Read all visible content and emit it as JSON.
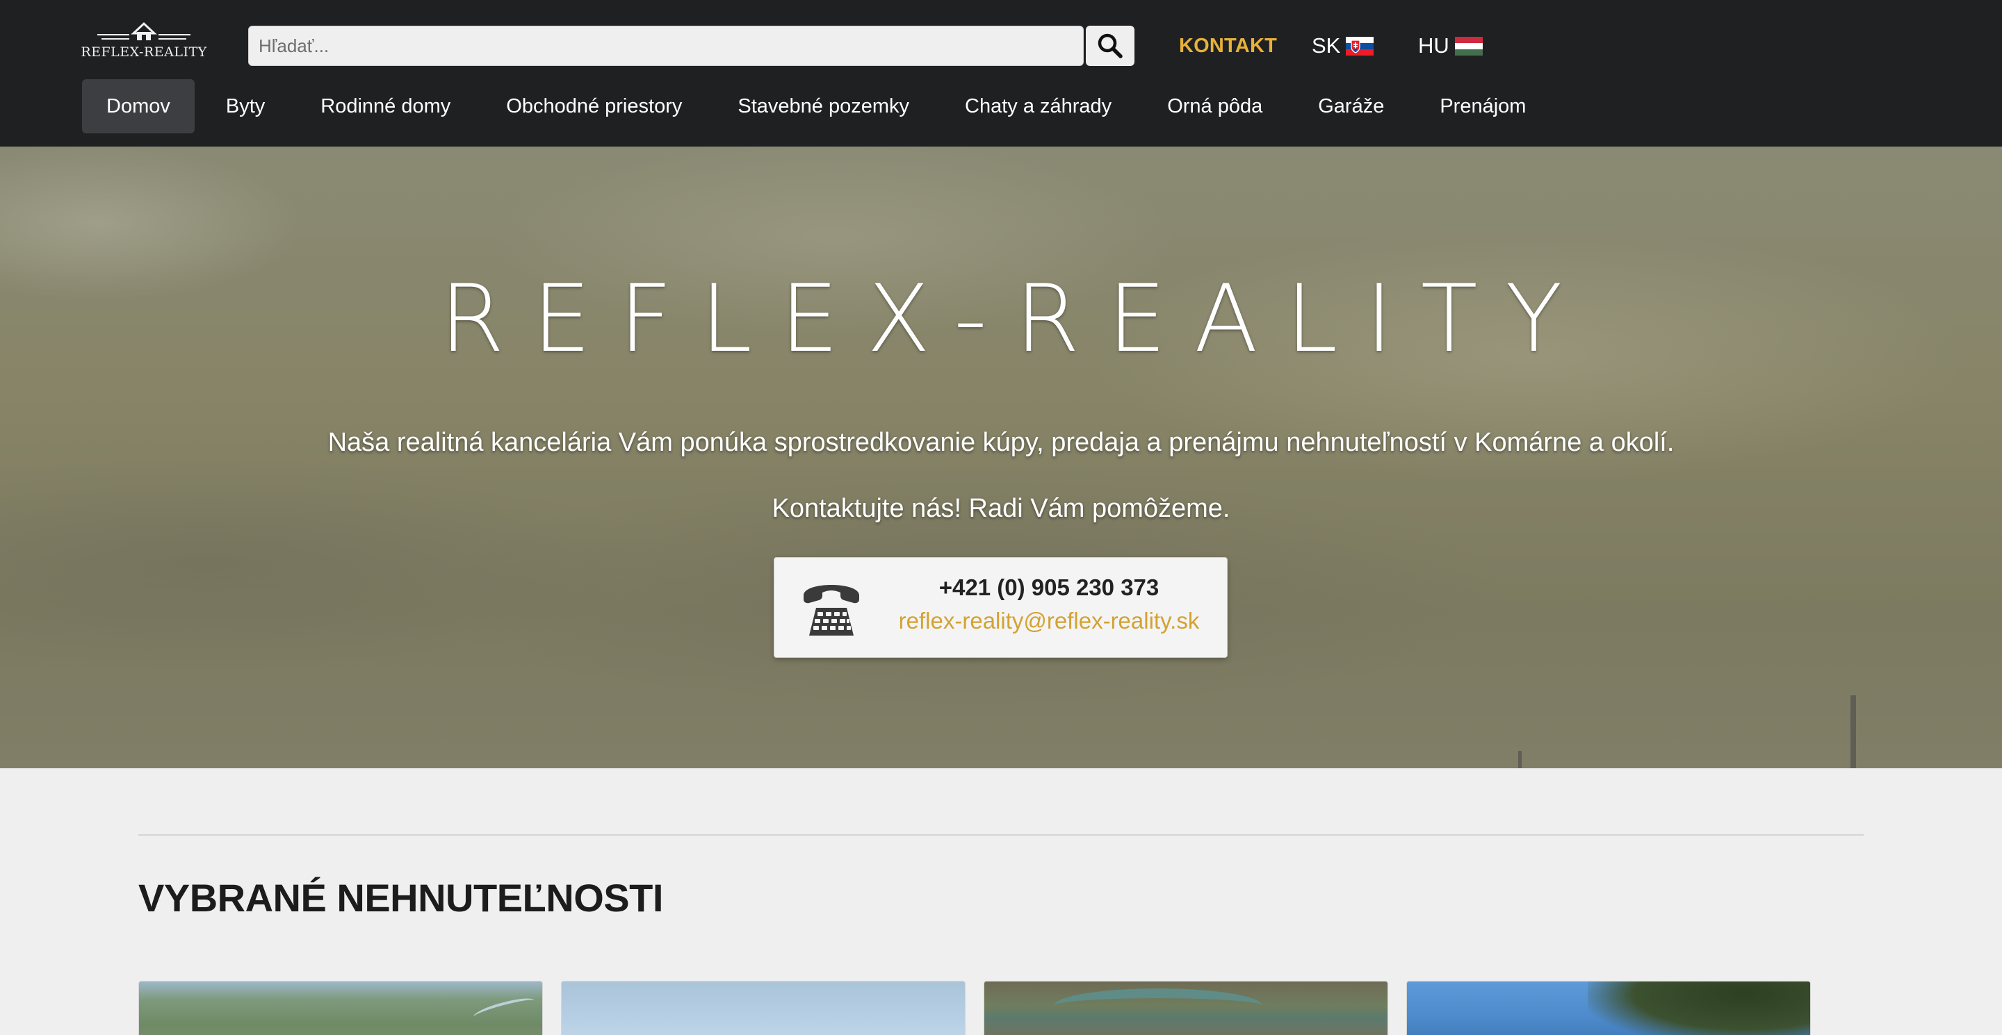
{
  "header": {
    "logo_text": "REFLEX-REALITY",
    "search": {
      "placeholder": "Hľadať..."
    },
    "kontakt_label": "KONTAKT",
    "languages": [
      {
        "code": "SK",
        "flag": "sk-flag-icon"
      },
      {
        "code": "HU",
        "flag": "hu-flag-icon"
      }
    ]
  },
  "nav": {
    "items": [
      {
        "label": "Domov",
        "active": true
      },
      {
        "label": "Byty"
      },
      {
        "label": "Rodinné domy"
      },
      {
        "label": "Obchodné priestory"
      },
      {
        "label": "Stavebné pozemky"
      },
      {
        "label": "Chaty a záhrady"
      },
      {
        "label": "Orná pôda"
      },
      {
        "label": "Garáže"
      },
      {
        "label": "Prenájom"
      }
    ]
  },
  "hero": {
    "title": "REFLEX-REALITY",
    "description": "Naša realitná kancelária Vám ponúka sprostredkovanie kúpy, predaja a prenájmu nehnuteľností v Komárne a okolí.",
    "cta": "Kontaktujte nás! Radi Vám pomôžeme.",
    "phone": "+421 (0) 905 230 373",
    "email": "reflex-reality@reflex-reality.sk"
  },
  "featured": {
    "title": "VYBRANÉ NEHNUTEĽNOSTI"
  },
  "colors": {
    "header_bg": "#1f2022",
    "accent": "#e7b13a",
    "email": "#d3a232",
    "page_bg": "#efefef"
  }
}
